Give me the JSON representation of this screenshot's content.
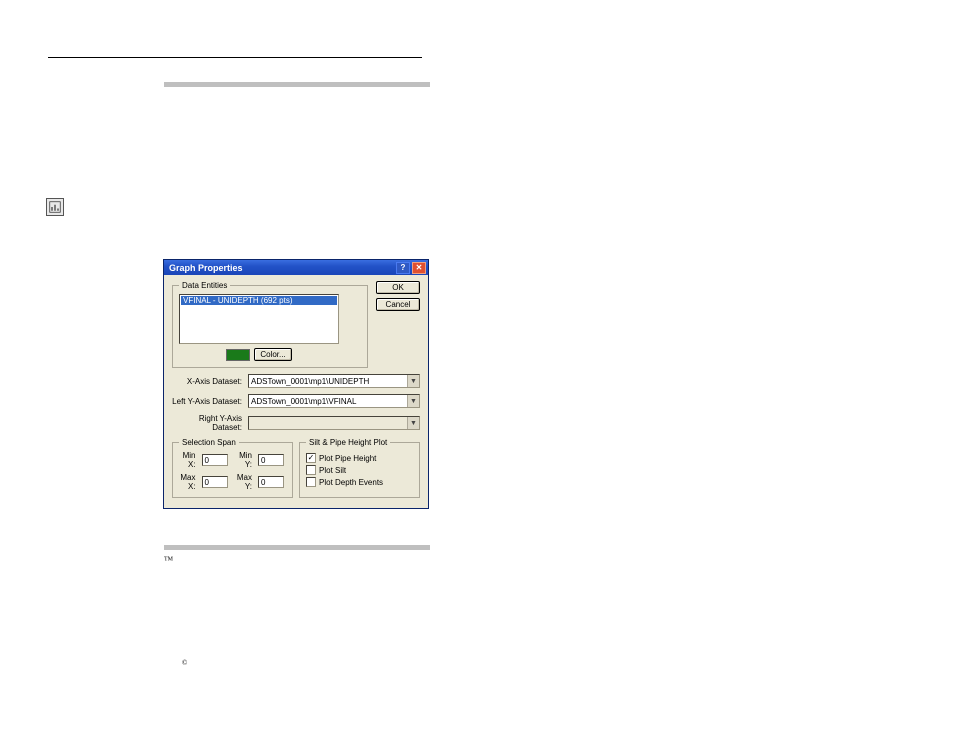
{
  "header": {
    "left": "",
    "right": ""
  },
  "icon_name": "graph-properties-icon",
  "dialog": {
    "title": "Graph Properties",
    "help_label": "?",
    "close_label": "✕",
    "data_entities_legend": "Data Entities",
    "selected_entity": "VFINAL - UNIDEPTH (692 pts)",
    "color_button": "Color...",
    "ok": "OK",
    "cancel": "Cancel",
    "x_axis_label": "X-Axis Dataset:",
    "x_axis_value": "ADSTown_0001\\mp1\\UNIDEPTH",
    "left_y_label": "Left Y-Axis Dataset:",
    "left_y_value": "ADSTown_0001\\mp1\\VFINAL",
    "right_y_label": "Right Y-Axis Dataset:",
    "right_y_value": "",
    "selection_span": {
      "legend": "Selection Span",
      "minx_label": "Min X:",
      "miny_label": "Min Y:",
      "maxx_label": "Max X:",
      "maxy_label": "Max Y:",
      "minx": "0",
      "miny": "0",
      "maxx": "0",
      "maxy": "0"
    },
    "silt_pipe": {
      "legend": "Silt & Pipe Height Plot",
      "plot_pipe_height": "Plot Pipe Height",
      "plot_silt": "Plot Silt",
      "plot_depth_events": "Plot Depth Events",
      "pipe_checked": "✓"
    }
  },
  "tm_mark": "TM",
  "copyright": "©"
}
